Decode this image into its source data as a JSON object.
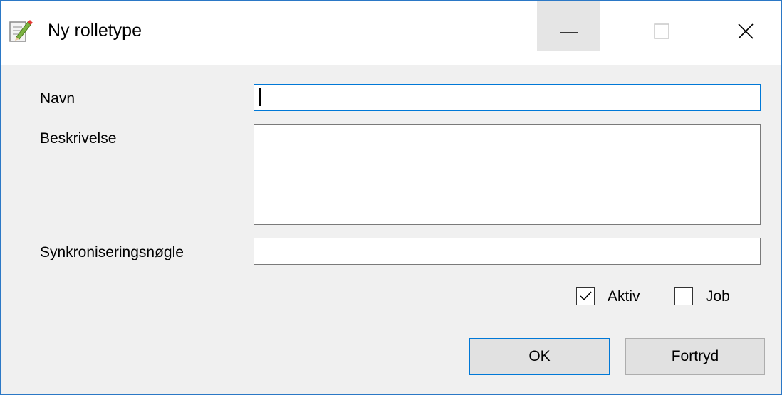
{
  "window": {
    "title": "Ny rolletype",
    "icon": "edit-document-icon",
    "controls": {
      "minimize": "minimize-icon",
      "maximize": "maximize-icon",
      "close": "close-icon"
    }
  },
  "form": {
    "name": {
      "label": "Navn",
      "value": ""
    },
    "description": {
      "label": "Beskrivelse",
      "value": ""
    },
    "sync_key": {
      "label": "Synkroniseringsnøgle",
      "value": ""
    },
    "active": {
      "label": "Aktiv",
      "checked": true
    },
    "job": {
      "label": "Job",
      "checked": false
    }
  },
  "buttons": {
    "ok": "OK",
    "cancel": "Fortryd"
  },
  "colors": {
    "accent": "#0078d7",
    "window_border": "#2b78c6",
    "background": "#f0f0f0"
  }
}
